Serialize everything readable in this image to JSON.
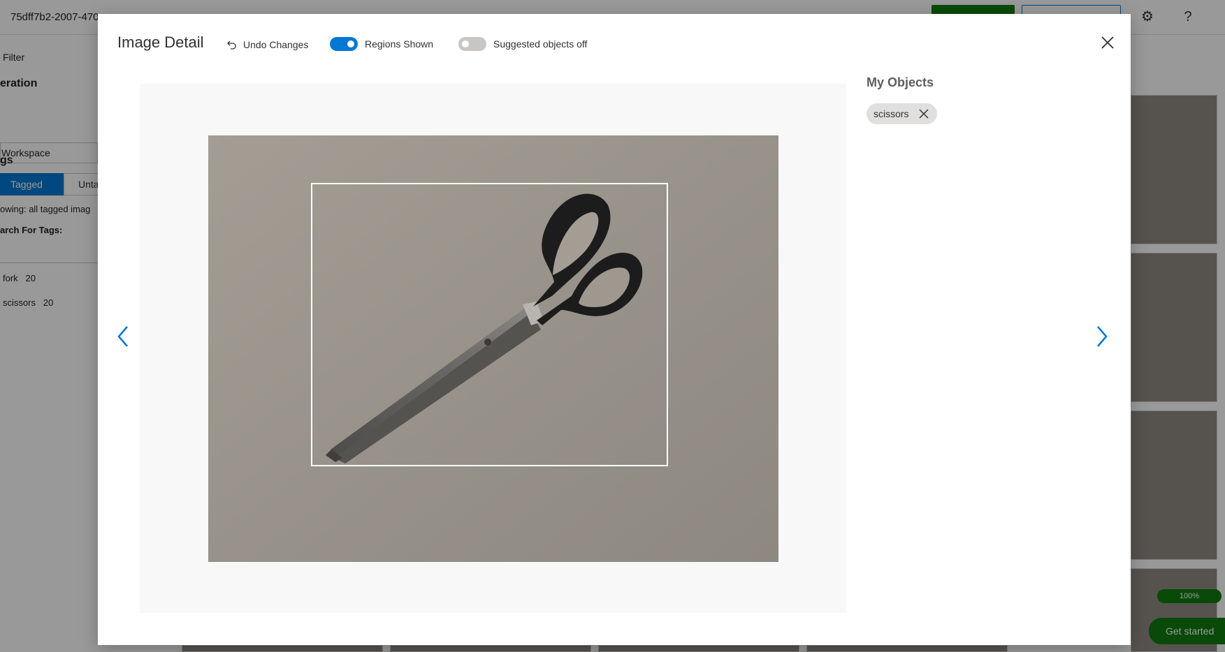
{
  "background": {
    "project_id": "75dff7b2-2007-470",
    "filter_label": "Filter",
    "iteration_heading": "eration",
    "workspace_label": "Workspace",
    "tags_heading": "gs",
    "tab_tagged": "Tagged",
    "tab_untagged": "Unta",
    "showing_text": "owing: all tagged imag",
    "search_label": "arch For Tags:",
    "tags": [
      {
        "name": "fork",
        "count": "20"
      },
      {
        "name": "scissors",
        "count": "20"
      }
    ],
    "progress_text": "100%",
    "get_started": "Get started",
    "icons": [
      "settings-icon",
      "help-icon"
    ]
  },
  "modal": {
    "title": "Image Detail",
    "undo_label": "Undo Changes",
    "regions_toggle": {
      "label": "Regions Shown",
      "on": true
    },
    "suggested_toggle": {
      "label": "Suggested objects off",
      "on": false
    },
    "objects_heading": "My Objects",
    "objects": [
      {
        "label": "scissors"
      }
    ],
    "icons": [
      "undo-icon",
      "close-icon",
      "chevron-left-icon",
      "chevron-right-icon",
      "remove-tag-icon"
    ]
  },
  "colors": {
    "accent": "#0078d4",
    "success": "#107c10",
    "chip": "#e1dfdd"
  }
}
